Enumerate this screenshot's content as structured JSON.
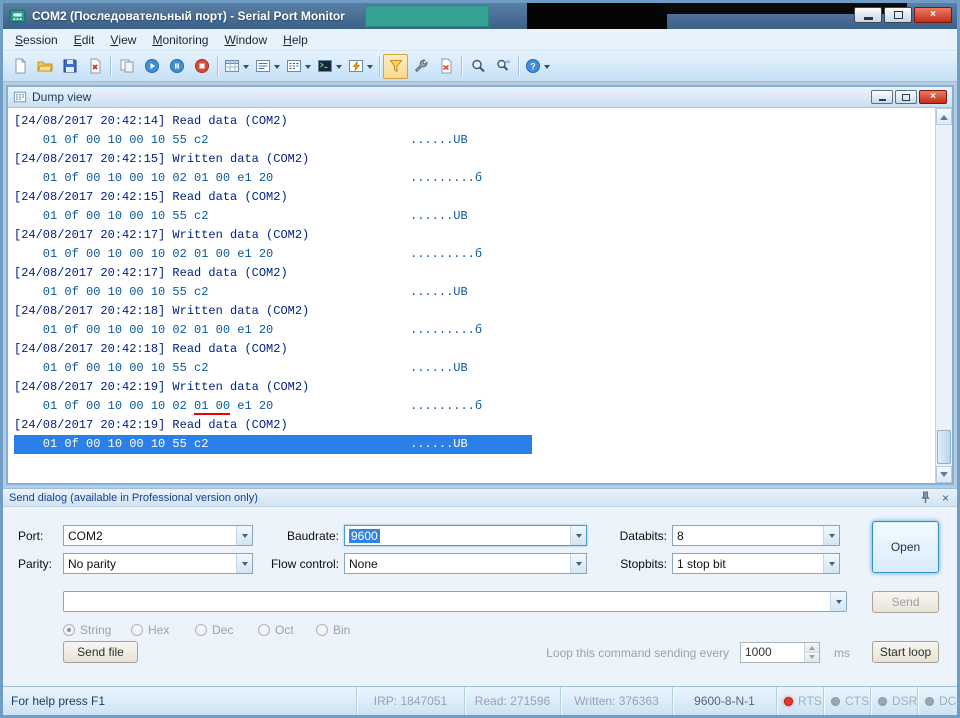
{
  "window": {
    "title": "COM2 (Последовательный порт) - Serial Port Monitor",
    "close_glyph": "×"
  },
  "menu": {
    "items": [
      "Session",
      "Edit",
      "View",
      "Monitoring",
      "Window",
      "Help"
    ]
  },
  "toolbar": {
    "buttons": [
      {
        "name": "new-session"
      },
      {
        "name": "open-session"
      },
      {
        "name": "save-session"
      },
      {
        "name": "close-session"
      },
      {
        "name": "export-data",
        "sep_before": true
      },
      {
        "name": "start-monitoring"
      },
      {
        "name": "pause-monitoring"
      },
      {
        "name": "stop-monitoring"
      },
      {
        "name": "table-view",
        "dropdown": true,
        "sep_before": true
      },
      {
        "name": "line-view",
        "dropdown": true
      },
      {
        "name": "dump-view",
        "dropdown": true
      },
      {
        "name": "terminal-view",
        "dropdown": true
      },
      {
        "name": "events-view",
        "dropdown": true
      },
      {
        "name": "filter-setup",
        "active": true,
        "sep_before": true
      },
      {
        "name": "advanced-settings"
      },
      {
        "name": "clear-views"
      },
      {
        "name": "find",
        "sep_before": true
      },
      {
        "name": "find-next"
      },
      {
        "name": "help",
        "dropdown": true,
        "sep_before": true
      }
    ]
  },
  "dump_view": {
    "title": "Dump view",
    "log": [
      {
        "header": "[24/08/2017 20:42:14] Read data (COM2)",
        "hex": "01 0f 00 10 00 10 55 c2",
        "ascii": "......UB",
        "selected": false
      },
      {
        "header": "[24/08/2017 20:42:15] Written data (COM2)",
        "hex": "01 0f 00 10 00 10 02 01 00 e1 20",
        "ascii": ".........б",
        "selected": false
      },
      {
        "header": "[24/08/2017 20:42:15] Read data (COM2)",
        "hex": "01 0f 00 10 00 10 55 c2",
        "ascii": "......UB",
        "selected": false
      },
      {
        "header": "[24/08/2017 20:42:17] Written data (COM2)",
        "hex": "01 0f 00 10 00 10 02 01 00 e1 20",
        "ascii": ".........б",
        "selected": false
      },
      {
        "header": "[24/08/2017 20:42:17] Read data (COM2)",
        "hex": "01 0f 00 10 00 10 55 c2",
        "ascii": "......UB",
        "selected": false
      },
      {
        "header": "[24/08/2017 20:42:18] Written data (COM2)",
        "hex": "01 0f 00 10 00 10 02 01 00 e1 20",
        "ascii": ".........б",
        "selected": false
      },
      {
        "header": "[24/08/2017 20:42:18] Read data (COM2)",
        "hex": "01 0f 00 10 00 10 55 c2",
        "ascii": "......UB",
        "selected": false
      },
      {
        "header": "[24/08/2017 20:42:19] Written data (COM2)",
        "hex_pre": "01 0f 00 10 00 10 02 ",
        "hex_marked": "01 00",
        "hex_post": " e1 20",
        "ascii": ".........б",
        "selected": false
      },
      {
        "header": "[24/08/2017 20:42:19] Read data (COM2)",
        "hex": "01 0f 00 10 00 10 55 c2",
        "ascii": "......UB",
        "selected": true
      }
    ]
  },
  "send_dialog": {
    "header": "Send dialog (available in Professional version only)",
    "fields": {
      "port": {
        "label": "Port:",
        "value": "COM2"
      },
      "baudrate": {
        "label": "Baudrate:",
        "value": "9600"
      },
      "databits": {
        "label": "Databits:",
        "value": "8"
      },
      "parity": {
        "label": "Parity:",
        "value": "No parity"
      },
      "flow": {
        "label": "Flow control:",
        "value": "None"
      },
      "stopbits": {
        "label": "Stopbits:",
        "value": "1 stop bit"
      }
    },
    "command_input": {
      "value": ""
    },
    "buttons": {
      "open": "Open",
      "send": "Send",
      "send_file": "Send file",
      "start_loop": "Start loop"
    },
    "radios": [
      {
        "label": "String",
        "selected": true
      },
      {
        "label": "Hex",
        "selected": false
      },
      {
        "label": "Dec",
        "selected": false
      },
      {
        "label": "Oct",
        "selected": false
      },
      {
        "label": "Bin",
        "selected": false
      }
    ],
    "loop": {
      "text": "Loop this command sending every",
      "value": "1000",
      "unit": "ms"
    }
  },
  "statusbar": {
    "help": "For help press F1",
    "irp": "IRP: 1847051",
    "read": "Read: 271596",
    "written": "Written: 376363",
    "line_params": "9600-8-N-1",
    "signals": [
      {
        "label": "RTS",
        "active": true
      },
      {
        "label": "CTS",
        "active": false
      },
      {
        "label": "DSR",
        "active": false
      },
      {
        "label": "DCD",
        "active": false
      }
    ]
  }
}
